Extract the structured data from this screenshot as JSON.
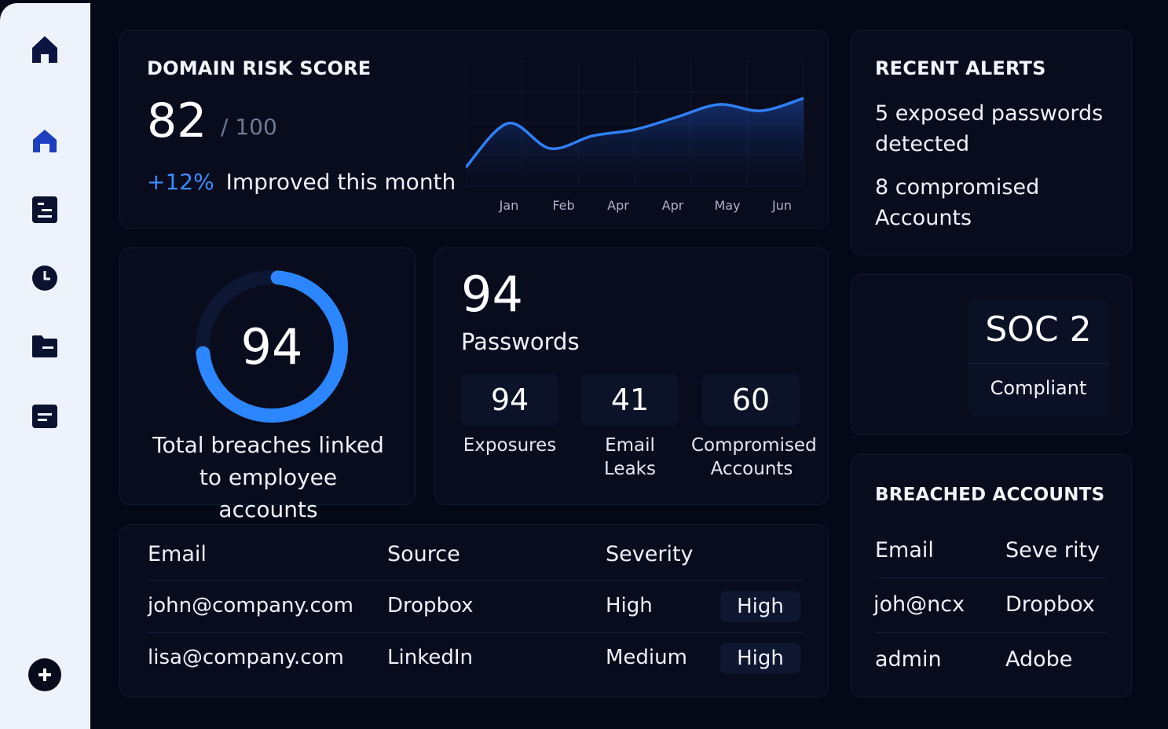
{
  "sidebar": {
    "items": [
      {
        "icon": "home-icon"
      },
      {
        "icon": "home-outline-icon"
      },
      {
        "icon": "list-icon"
      },
      {
        "icon": "clock-icon"
      },
      {
        "icon": "folder-icon"
      },
      {
        "icon": "document-icon"
      }
    ],
    "add_icon": "plus-circle-icon"
  },
  "risk": {
    "title": "DOMAIN RISK SCORE",
    "score": "82",
    "max": "/ 100",
    "change": "+12%",
    "change_text": "Improved this month",
    "accent_color": "#3a8dff"
  },
  "chart_data": {
    "type": "area",
    "categories": [
      "Jan",
      "Feb",
      "Apr",
      "Apr",
      "May",
      "Jun"
    ],
    "values": [
      73,
      80,
      76,
      78,
      79,
      81,
      83,
      82,
      84
    ],
    "value_points": 9,
    "ylim": [
      70,
      90
    ],
    "grid": true,
    "color": "#2f7ff5"
  },
  "alerts": {
    "title": "RECENT ALERTS",
    "items": [
      "5 exposed passwords detected",
      "8 compromised Accounts"
    ]
  },
  "breaches": {
    "value": "94",
    "progress": 0.72,
    "caption": "Total breaches linked to employee accounts"
  },
  "passwords": {
    "count": "94",
    "label": "Passwords",
    "stats": [
      {
        "value": "94",
        "label": "Exposures"
      },
      {
        "value": "41",
        "label": "Email Leaks"
      },
      {
        "value": "60",
        "label": "Compromised Accounts"
      }
    ]
  },
  "table": {
    "headers": [
      "Email",
      "Source",
      "Severity"
    ],
    "rows": [
      {
        "email": "john@company.com",
        "source": "Dropbox",
        "severity": "High",
        "badge": "High"
      },
      {
        "email": "lisa@company.com",
        "source": "LinkedIn",
        "severity": "Medium",
        "badge": "High"
      }
    ]
  },
  "soc": {
    "title": "SOC 2",
    "status": "Compliant"
  },
  "accounts": {
    "title": "BREACHED ACCOUNTS",
    "headers": [
      "Email",
      "Seve rity"
    ],
    "rows": [
      {
        "email": "joh@ncx",
        "source": "Dropbox"
      },
      {
        "email": "admin",
        "source": "Adobe"
      }
    ]
  }
}
